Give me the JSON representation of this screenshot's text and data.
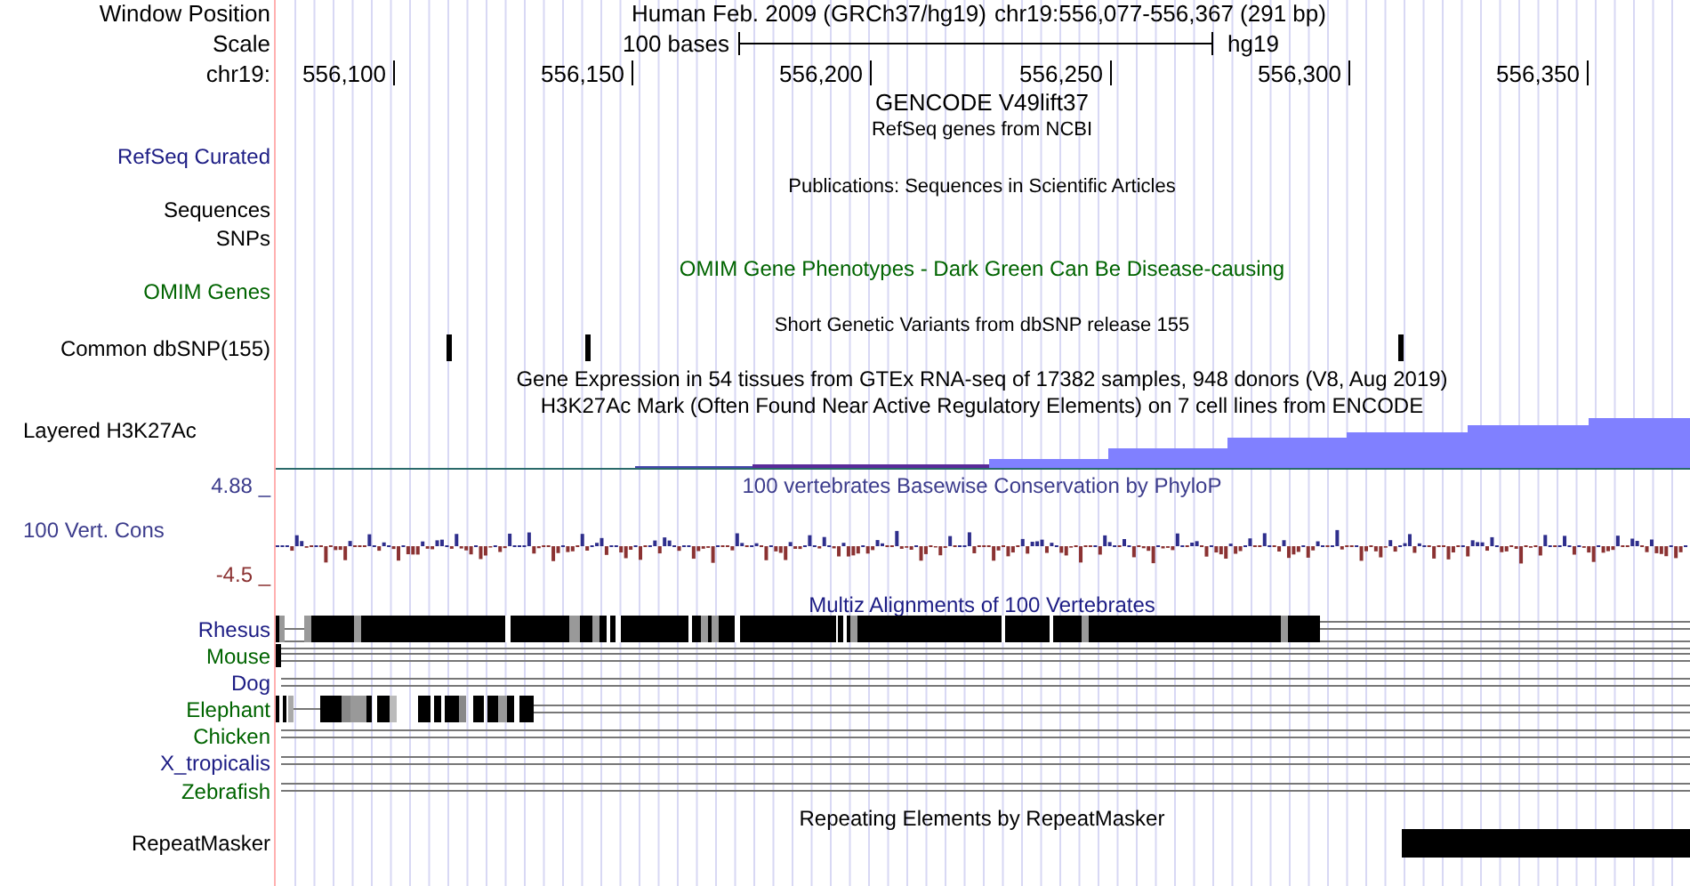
{
  "header": {
    "assembly": "Human Feb. 2009 (GRCh37/hg19)",
    "position": "chr19:556,077-556,367 (291 bp)"
  },
  "ruler": {
    "scale_text": "100 bases",
    "scale_assembly": "hg19",
    "ticks": [
      "556,100",
      "556,150",
      "556,200",
      "556,250",
      "556,300",
      "556,350"
    ]
  },
  "side_labels": [
    {
      "kind": "plain",
      "text": "Window Position",
      "color": "#000000"
    },
    {
      "kind": "plain",
      "text": "Scale",
      "color": "#000000"
    },
    {
      "kind": "plain",
      "text": "chr19:",
      "color": "#000000"
    },
    {
      "kind": "track",
      "text": "RefSeq Curated",
      "color": "#1c1c84"
    },
    {
      "kind": "track",
      "text": "Sequences",
      "color": "#000000"
    },
    {
      "kind": "track",
      "text": "SNPs",
      "color": "#000000"
    },
    {
      "kind": "track",
      "text": "OMIM Genes",
      "color": "#006400"
    },
    {
      "kind": "track",
      "text": "Common dbSNP(155)",
      "color": "#000000"
    },
    {
      "kind": "track_left",
      "text": "Layered H3K27Ac",
      "color": "#000000"
    },
    {
      "kind": "axis",
      "text": "4.88 _",
      "color": "#3c3c8c"
    },
    {
      "kind": "track_left",
      "text": "100 Vert. Cons",
      "color": "#3c3c8c"
    },
    {
      "kind": "axis",
      "text": "-4.5 _",
      "color": "#8b3232"
    },
    {
      "kind": "species",
      "text": "Rhesus",
      "color": "#1c1c84"
    },
    {
      "kind": "species",
      "text": "Mouse",
      "color": "#006400"
    },
    {
      "kind": "species",
      "text": "Dog",
      "color": "#1c1c84"
    },
    {
      "kind": "species",
      "text": "Elephant",
      "color": "#006400"
    },
    {
      "kind": "species",
      "text": "Chicken",
      "color": "#006400"
    },
    {
      "kind": "species",
      "text": "X_tropicalis",
      "color": "#1c1c84"
    },
    {
      "kind": "species",
      "text": "Zebrafish",
      "color": "#006400"
    },
    {
      "kind": "track",
      "text": "RepeatMasker",
      "color": "#000000"
    }
  ],
  "track_titles": [
    {
      "text": "GENCODE V49lift37",
      "color": "#000000"
    },
    {
      "text": "RefSeq genes from NCBI",
      "color": "#000000"
    },
    {
      "text": "Publications: Sequences in Scientific Articles",
      "color": "#000000"
    },
    {
      "text": "OMIM Gene Phenotypes - Dark Green Can Be Disease-causing",
      "color": "#006400"
    },
    {
      "text": "Short Genetic Variants from dbSNP release 155",
      "color": "#000000"
    },
    {
      "text": "Gene Expression in 54 tissues from GTEx RNA-seq of 17382 samples, 948 donors (V8, Aug 2019)",
      "color": "#000000"
    },
    {
      "text": "H3K27Ac Mark (Often Found Near Active Regulatory Elements) on 7 cell lines from ENCODE",
      "color": "#000000"
    },
    {
      "text": "100 vertebrates Basewise Conservation by PhyloP",
      "color": "#3c3c8c"
    },
    {
      "text": "Multiz Alignments of 100 Vertebrates",
      "color": "#1c1c84"
    },
    {
      "text": "Repeating Elements by RepeatMasker",
      "color": "#000000"
    }
  ]
}
